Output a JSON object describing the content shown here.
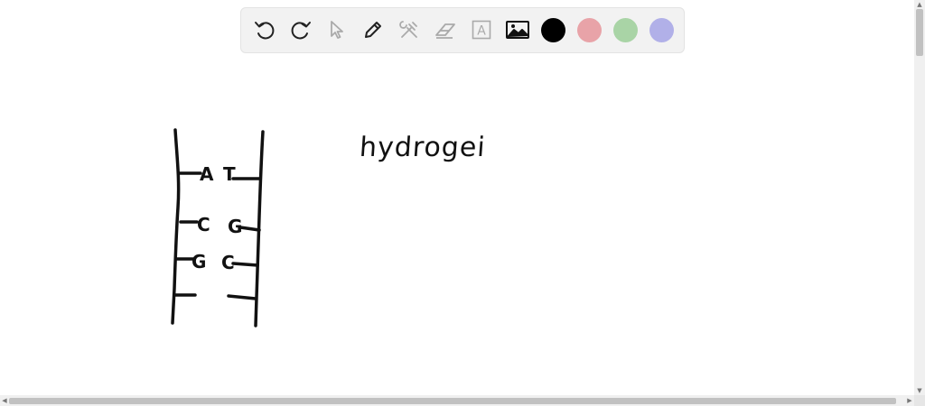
{
  "toolbar": {
    "tools": [
      {
        "name": "undo-icon"
      },
      {
        "name": "redo-icon"
      },
      {
        "name": "select-pointer-icon"
      },
      {
        "name": "pen-icon"
      },
      {
        "name": "tools-icon"
      },
      {
        "name": "eraser-icon"
      },
      {
        "name": "text-box-icon",
        "glyph": "A"
      },
      {
        "name": "image-icon"
      }
    ],
    "colors": {
      "black": "#000000",
      "pink": "#e8a3a8",
      "green": "#a9d4a6",
      "lavender": "#b1b0e8"
    }
  },
  "canvas": {
    "handwritten_text": "hydrogei",
    "dna_labels": {
      "row1_left": "A",
      "row1_right": "T",
      "row2_left": "C",
      "row2_right": "G",
      "row3_left": "G",
      "row3_right": "C"
    }
  }
}
